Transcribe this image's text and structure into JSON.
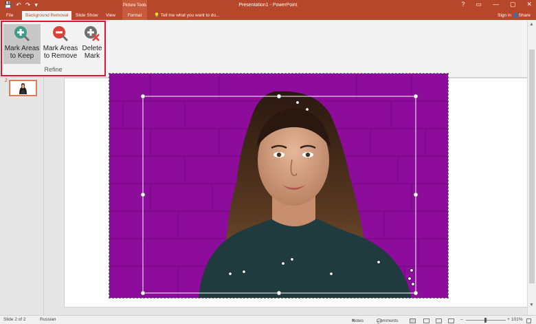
{
  "window": {
    "title": "Presentation1 - PowerPoint",
    "context_group": "Picture Tools",
    "controls": [
      "?",
      "▭",
      "—",
      "▢",
      "✕"
    ]
  },
  "qat": {
    "save": "💾",
    "undo": "↶",
    "redo": "↷",
    "customize": "▾"
  },
  "tabs": {
    "file": "File",
    "background_removal": "Background Removal",
    "slide_show": "Slide Show",
    "view": "View",
    "format": "Format",
    "tell_me": "Tell me what you want to do...",
    "sign_in": "Sign in",
    "share": "Share"
  },
  "ribbon": {
    "mark_keep": "Mark Areas to Keep",
    "mark_remove": "Mark Areas to Remove",
    "delete_mark": "Delete Mark",
    "group": "Refine",
    "collapse": "^"
  },
  "slide_pane": {
    "number": "2"
  },
  "status": {
    "slide": "Slide 2 of 2",
    "language": "Russian",
    "notes": "Notes",
    "comments": "Comments",
    "zoom": "101%",
    "zoom_out": "–",
    "zoom_in": "+"
  },
  "colors": {
    "accent": "#b7472a",
    "background_removal": "#8e0c9c",
    "highlight": "#e0142b"
  }
}
